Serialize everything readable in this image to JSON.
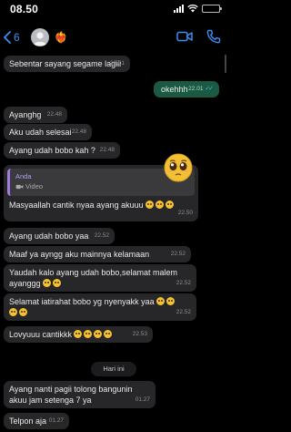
{
  "status_bar": {
    "time": "08.50",
    "battery_level": 0.75
  },
  "header": {
    "back_count": "6",
    "contact_name": "❤️‍🔥",
    "icons": [
      "video-camera-icon",
      "phone-icon"
    ]
  },
  "date_separator": "Hari ini",
  "messages": [
    {
      "dir": "in",
      "text": "Sebentar sayang segame lagiii",
      "time": "22.01"
    },
    {
      "dir": "out",
      "text": "okehhh",
      "time": "22.01",
      "read": true
    },
    {
      "dir": "in",
      "text": "Ayanghg",
      "time": "22.48"
    },
    {
      "dir": "in",
      "text": "Aku udah selesai",
      "time": "22.48"
    },
    {
      "dir": "in",
      "text": "Ayang udah bobo kah ?",
      "time": "22.48"
    },
    {
      "dir": "in",
      "quote_name": "Anda",
      "quote_type": "Video",
      "text": "Masyaallah cantik nyaa ayang akuuu",
      "emoji_count": 3,
      "time": "22.50"
    },
    {
      "dir": "in",
      "text": "Ayang udah bobo yaa",
      "time": "22.52"
    },
    {
      "dir": "in",
      "text": "Maaf ya ayngg aku mainnya kelamaan",
      "time": "22.52"
    },
    {
      "dir": "in",
      "text": "Yaudah kalo ayang udah bobo,selamat malem ayanggg",
      "emoji_count": 2,
      "time": "22.52"
    },
    {
      "dir": "in",
      "text": "Selamat iatirahat bobo yg nyenyakk yaa",
      "emoji_count": 4,
      "time": "22.52"
    },
    {
      "dir": "in",
      "text": "Lovyuuu cantikkk",
      "emoji_count": 4,
      "time": "22.53"
    },
    {
      "dir": "in",
      "text": "Ayang nanti pagii tolong bangunin akuu jam setenga 7 ya",
      "time": "01.27"
    },
    {
      "dir": "in",
      "text": "Telpon aja",
      "time": "01.27"
    }
  ]
}
